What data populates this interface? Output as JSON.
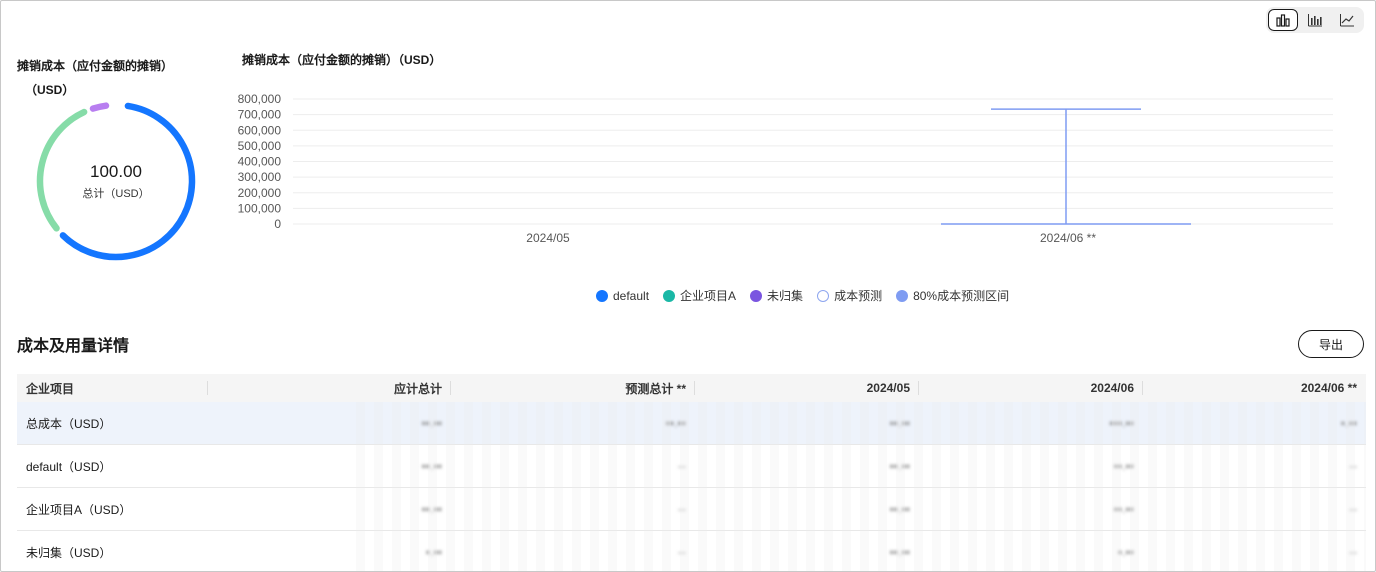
{
  "switcher": {
    "items": [
      "bar-chart-icon",
      "column-chart-icon",
      "line-chart-icon"
    ]
  },
  "donut": {
    "title_line1": "摊销成本（应付金额的摊销）",
    "title_line2": "（USD）",
    "center_value": "100.00",
    "center_label": "总计（USD）",
    "segments": [
      {
        "name": "default",
        "fraction": 0.61,
        "color": "#1476ff"
      },
      {
        "name": "企业项目A",
        "fraction": 0.3,
        "color": "#86dca8"
      },
      {
        "name": "未归集",
        "fraction": 0.04,
        "color": "#b87ef0"
      }
    ]
  },
  "chart": {
    "title": "摊销成本（应付金额的摊销）（USD）"
  },
  "chart_data": {
    "type": "line",
    "title": "摊销成本（应付金额的摊销）（USD）",
    "categories": [
      "2024/05",
      "2024/06 **"
    ],
    "yticks": [
      "800,000",
      "700,000",
      "600,000",
      "500,000",
      "400,000",
      "300,000",
      "200,000",
      "100,000",
      "0"
    ],
    "ylim": [
      0,
      800000
    ],
    "series": [
      {
        "name": "成本预测",
        "values": [
          null,
          0
        ]
      },
      {
        "name": "80%成本预测区间",
        "values": [
          null,
          0
        ],
        "range": [
          0,
          735000
        ]
      }
    ],
    "legend_position": "bottom",
    "grid": true
  },
  "legend": [
    {
      "label": "default",
      "color": "#1476ff",
      "hollow": false
    },
    {
      "label": "企业项目A",
      "color": "#1ab8a6",
      "hollow": false
    },
    {
      "label": "未归集",
      "color": "#7a55e0",
      "hollow": false
    },
    {
      "label": "成本预测",
      "color": "#8ea6ef",
      "hollow": true
    },
    {
      "label": "80%成本预测区间",
      "color": "#7f9cf2",
      "hollow": false
    }
  ],
  "section": {
    "title": "成本及用量详情",
    "export_label": "导出"
  },
  "table": {
    "headers": [
      "企业项目",
      "应计总计",
      "预测总计 **",
      "2024/05",
      "2024/06",
      "2024/06 **"
    ],
    "rows": [
      {
        "name": "总成本（USD）",
        "cells": [
          "▪▪.▪▪",
          "▪▪.▪▪",
          "▪▪.▪▪",
          "▪▪▪.▪▪",
          "▪.▪▪"
        ]
      },
      {
        "name": "default（USD）",
        "cells": [
          "▪▪.▪▪",
          "--",
          "▪▪.▪▪",
          "▪▪.▪▪",
          "--"
        ]
      },
      {
        "name": "企业项目A（USD）",
        "cells": [
          "▪▪.▪▪",
          "--",
          "▪▪.▪▪",
          "▪▪.▪▪",
          "--"
        ]
      },
      {
        "name": "未归集（USD）",
        "cells": [
          "▪.▪▪",
          "--",
          "▪▪.▪▪",
          "▪.▪▪",
          "--"
        ]
      }
    ]
  }
}
